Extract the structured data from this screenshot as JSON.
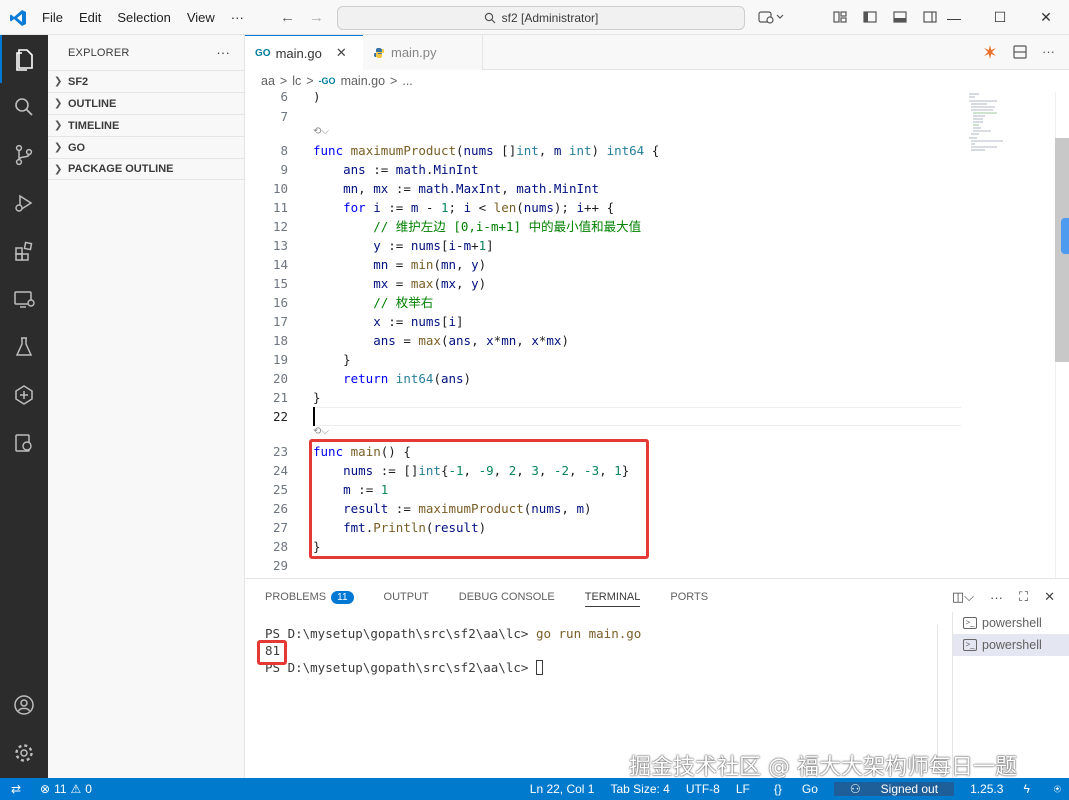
{
  "titlebar": {
    "menu": [
      "File",
      "Edit",
      "Selection",
      "View",
      "···"
    ],
    "search": "sf2 [Administrator]"
  },
  "sidebar": {
    "title": "EXPLORER",
    "more": "···",
    "sections": [
      "SF2",
      "OUTLINE",
      "TIMELINE",
      "GO",
      "PACKAGE OUTLINE"
    ]
  },
  "tabs": [
    {
      "label": "main.go",
      "icon": "GO",
      "active": true
    },
    {
      "label": "main.py",
      "icon": "py",
      "active": false
    }
  ],
  "breadcrumb": [
    "aa",
    ">",
    "lc",
    ">",
    "main.go",
    ">",
    "..."
  ],
  "editor": {
    "line_numbers": [
      "6",
      "7",
      "8",
      "9",
      "10",
      "11",
      "12",
      "13",
      "14",
      "15",
      "16",
      "17",
      "18",
      "19",
      "20",
      "21",
      "22",
      "23",
      "24",
      "25",
      "26",
      "27",
      "28",
      "29"
    ]
  },
  "panel": {
    "tabs": [
      "PROBLEMS",
      "OUTPUT",
      "DEBUG CONSOLE",
      "TERMINAL",
      "PORTS"
    ],
    "problems_count": "11",
    "active_tab": "TERMINAL",
    "terminal": {
      "prompt1": "PS D:\\mysetup\\gopath\\src\\sf2\\aa\\lc> ",
      "command": "go run main.go",
      "output": "81",
      "prompt2": "PS D:\\mysetup\\gopath\\src\\sf2\\aa\\lc> "
    },
    "terminals": [
      "powershell",
      "powershell"
    ],
    "watermark": "掘金技术社区 @ 福大大架构师每日一题"
  },
  "statusbar": {
    "errors": "11",
    "warnings": "0",
    "position": "Ln 22, Col 1",
    "tabsize": "Tab Size: 4",
    "encoding": "UTF-8",
    "eol": "LF",
    "language": "Go",
    "account": "Signed out",
    "version": "1.25.3"
  },
  "colors": {
    "accent": "#0078d4",
    "statusbar": "#007acc",
    "highlight_box": "#e53935"
  }
}
